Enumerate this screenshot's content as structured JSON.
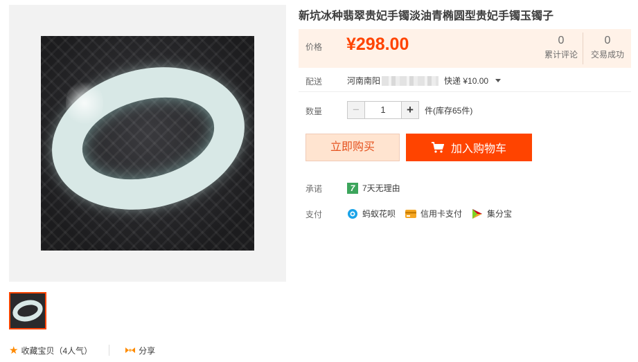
{
  "product": {
    "title": "新坑冰种翡翠贵妃手镯淡油青椭圆型贵妃手镯玉镯子"
  },
  "price": {
    "label": "价格",
    "value": "¥298.00"
  },
  "stats": [
    {
      "num": "0",
      "label": "累计评论"
    },
    {
      "num": "0",
      "label": "交易成功"
    }
  ],
  "shipping": {
    "label": "配送",
    "from": "河南南阳",
    "method": "快递 ¥10.00"
  },
  "quantity": {
    "label": "数量",
    "minus": "−",
    "value": "1",
    "plus": "+",
    "stock": "件(库存65件)"
  },
  "actions": {
    "buy_now": "立即购买",
    "add_to_cart": "加入购物车"
  },
  "promise": {
    "label": "承诺",
    "icon_text": "7",
    "text": "7天无理由"
  },
  "payment": {
    "label": "支付",
    "methods": [
      {
        "name": "蚂蚁花呗",
        "icon": "huabei-icon"
      },
      {
        "name": "信用卡支付",
        "icon": "credit-card-icon"
      },
      {
        "name": "集分宝",
        "icon": "jifenbao-icon"
      }
    ]
  },
  "social": {
    "favorite": "收藏宝贝（4人气）",
    "share": "分享"
  },
  "colors": {
    "accent": "#ff4400",
    "price_bg": "#fff2e8",
    "buy_bg": "#ffe4d0",
    "promise_green": "#3ca55c"
  }
}
